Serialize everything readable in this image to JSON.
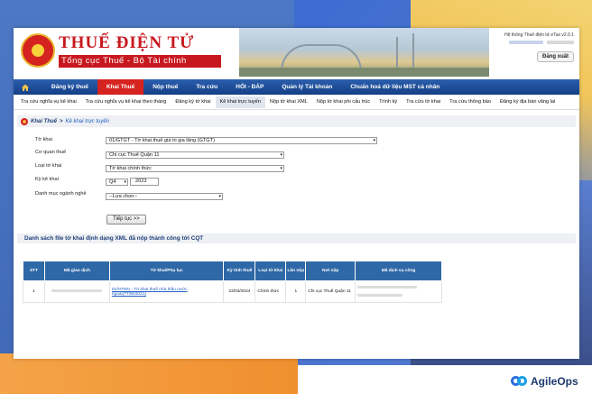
{
  "header": {
    "title": "THUẾ ĐIỆN TỬ",
    "subtitle": "Tổng cục Thuế - Bộ Tài chính",
    "system_version": "Hệ thống Thuế điện tử eTax v2.0.1",
    "logout": "Đăng xuất"
  },
  "nav": {
    "items": [
      {
        "label": "Đăng ký thuế"
      },
      {
        "label": "Khai Thuế",
        "active": true
      },
      {
        "label": "Nộp thuế"
      },
      {
        "label": "Tra cứu"
      },
      {
        "label": "HỎI - ĐÁP"
      },
      {
        "label": "Quản lý Tài khoản"
      },
      {
        "label": "Chuẩn hoá dữ liệu MST cá nhân"
      }
    ]
  },
  "subnav": {
    "items": [
      {
        "label": "Tra cứu nghĩa vụ kê khai"
      },
      {
        "label": "Tra cứu nghĩa vụ kê khai theo tháng"
      },
      {
        "label": "Đăng ký tờ khai"
      },
      {
        "label": "Kê khai trực tuyến",
        "active": true
      },
      {
        "label": "Nộp tờ khai XML"
      },
      {
        "label": "Nộp tờ khai phi cấu trúc"
      },
      {
        "label": "Trình ký"
      },
      {
        "label": "Tra cứu tờ khai"
      },
      {
        "label": "Tra cứu thông báo"
      },
      {
        "label": "Đăng ký địa bàn vãng lai"
      }
    ]
  },
  "breadcrumb": {
    "root": "Khai Thuế",
    "separator": ">",
    "current": "Kê khai trực tuyến"
  },
  "form": {
    "to_khai_label": "Tờ khai",
    "to_khai_value": "01/GTGT - Tờ khai thuế giá trị gia tăng (GTGT)",
    "co_quan_label": "Cơ quan thuế",
    "co_quan_value": "Chi cục Thuế Quận 11",
    "loai_label": "Loại tờ khai",
    "loai_value": "Tờ khai chính thức",
    "ky_label": "Kỳ kê khai",
    "ky_quarter": "Q4",
    "ky_year": "2023",
    "danh_muc_label": "Danh mục ngành nghề",
    "danh_muc_value": "--Lựa chọn--",
    "continue": "Tiếp tục >>"
  },
  "list": {
    "title": "Danh sách file tờ khai định dạng XML đã nộp thành công tới CQT",
    "columns": [
      "STT",
      "Mã giao dịch",
      "Tờ khai/Phụ lục",
      "Kỳ tính thuế",
      "Loại tờ khai",
      "Lần nộp",
      "Nơi nộp",
      "Mã dịch vụ công"
    ],
    "rows": [
      {
        "stt": "1",
        "form": "01/NTNN - Tờ khai thuế nhà thầu nước ngoài(TT80/2021)",
        "period": "22/03/2024",
        "type": "Chính thức",
        "times": "1",
        "place": "Chi cục Thuế Quận 11"
      }
    ]
  },
  "brand": {
    "name": "AgileOps"
  },
  "colors": {
    "brand_red": "#c8181f",
    "nav_blue": "#143f86",
    "table_header": "#2f68a6",
    "link": "#2160c4"
  }
}
